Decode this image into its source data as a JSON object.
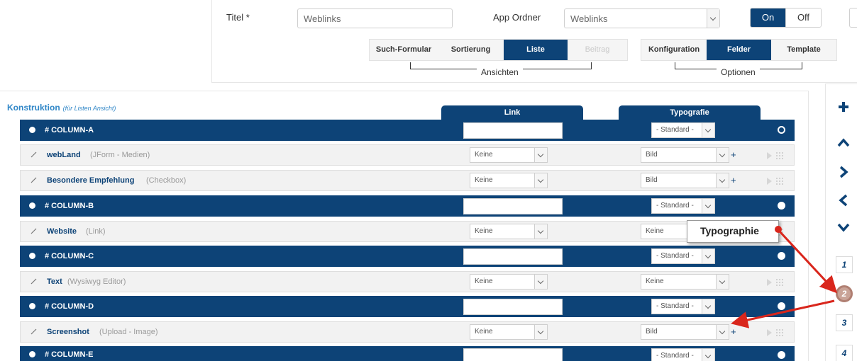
{
  "header": {
    "titel_label": "Titel *",
    "titel_value": "Weblinks",
    "app_ordner_label": "App Ordner",
    "app_ordner_value": "Weblinks",
    "toggle_on": "On",
    "toggle_off": "Off"
  },
  "ansichten": {
    "group_label": "Ansichten",
    "tabs": [
      "Such-Formular",
      "Sortierung",
      "Liste",
      "Beitrag"
    ],
    "active": "Liste"
  },
  "optionen": {
    "group_label": "Optionen",
    "tabs": [
      "Konfiguration",
      "Felder",
      "Template"
    ],
    "active": "Felder"
  },
  "konstruktion": {
    "title": "Konstruktion",
    "subtitle": "(für Listen Ansicht)",
    "col_headers": {
      "link": "Link",
      "typografie": "Typografie"
    }
  },
  "rows": [
    {
      "kind": "column",
      "name": "# COLUMN-A",
      "typo": "- Standard -"
    },
    {
      "kind": "field",
      "name": "webLand",
      "type": "(JForm - Medien)",
      "link": "Keine",
      "typo": "Bild"
    },
    {
      "kind": "field",
      "name": "Besondere Empfehlung",
      "type": "(Checkbox)",
      "link": "Keine",
      "typo": "Bild"
    },
    {
      "kind": "column",
      "name": "# COLUMN-B",
      "typo": "- Standard -"
    },
    {
      "kind": "field",
      "name": "Website",
      "type": "(Link)",
      "link": "Keine",
      "typo": "Keine"
    },
    {
      "kind": "column",
      "name": "# COLUMN-C",
      "typo": "- Standard -"
    },
    {
      "kind": "field",
      "name": "Text",
      "type": "(Wysiwyg Editor)",
      "link": "Keine",
      "typo": "Keine"
    },
    {
      "kind": "column",
      "name": "# COLUMN-D",
      "typo": "- Standard -"
    },
    {
      "kind": "field",
      "name": "Screenshot",
      "type": "(Upload - Image)",
      "link": "Keine",
      "typo": "Bild"
    },
    {
      "kind": "column",
      "name": "# COLUMN-E",
      "typo": "- Standard -"
    }
  ],
  "plus_sign": "+",
  "callout": {
    "text": "Typographie"
  },
  "sidebar": {
    "icons": [
      "plus-icon",
      "chevron-up-icon",
      "chevron-right-icon",
      "chevron-left-icon",
      "chevron-down-icon"
    ],
    "numbers": [
      "1",
      "2",
      "3",
      "4"
    ],
    "active_number": "2"
  },
  "colors": {
    "primary": "#0d4377",
    "accent": "#2f86c7",
    "annotation": "#d9261c"
  }
}
